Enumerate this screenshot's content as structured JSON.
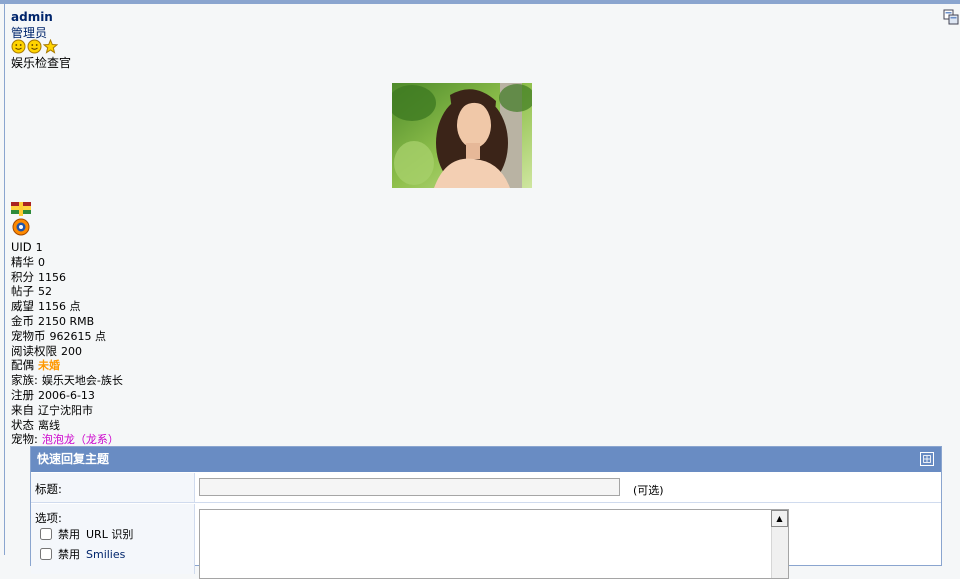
{
  "user": {
    "name": "admin",
    "group": "管理员",
    "title": "娱乐检查官"
  },
  "stats": [
    {
      "label": "UID",
      "value": "1"
    },
    {
      "label": "精华",
      "value": "0"
    },
    {
      "label": "积分",
      "value": "1156"
    },
    {
      "label": "帖子",
      "value": "52"
    },
    {
      "label": "威望",
      "value": "1156 点"
    },
    {
      "label": "金币",
      "value": "2150 RMB"
    },
    {
      "label": "宠物币",
      "value": "962615 点"
    },
    {
      "label": "阅读权限",
      "value": "200"
    },
    {
      "label": "配偶",
      "value": "未婚"
    },
    {
      "label": "家族:",
      "value": "娱乐天地会-族长"
    },
    {
      "label": "注册",
      "value": "2006-6-13"
    },
    {
      "label": "来自",
      "value": "辽宁沈阳市"
    },
    {
      "label": "状态",
      "value": "离线"
    },
    {
      "label": "宠物:",
      "value": "泡泡龙（龙系）"
    }
  ],
  "quick_reply": {
    "header": "快速回复主题",
    "subject_label": "标题:",
    "subject_value": "",
    "optional": "(可选)",
    "options_label": "选项:",
    "opt1_prefix": "禁用",
    "opt1_text": "URL 识别",
    "opt2_prefix": "禁用",
    "opt2_text": "Smilies"
  },
  "icons": {
    "corner": "profile-compare-icon",
    "rank_star_1": "smiley-icon",
    "rank_star_2": "smiley-icon",
    "rank_star_3": "star-icon",
    "medal": "medal-icon",
    "collapse": "collapse-icon"
  },
  "colors": {
    "accent": "#8aa5cf",
    "header_bg": "#698cc3",
    "username": "#00256c",
    "spouse": "#ff9900",
    "pet": "#cc00cc"
  }
}
